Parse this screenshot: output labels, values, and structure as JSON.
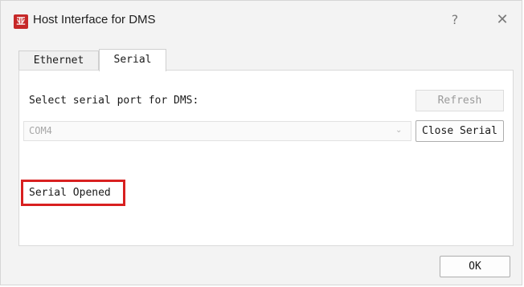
{
  "window": {
    "title": "Host Interface for DMS",
    "app_icon_glyph": "亚",
    "help_glyph": "?",
    "close_glyph": "✕"
  },
  "tabs": [
    {
      "label": "Ethernet",
      "selected": false
    },
    {
      "label": "Serial",
      "selected": true
    }
  ],
  "serial": {
    "select_label": "Select serial port for DMS:",
    "refresh_label": "Refresh",
    "refresh_enabled": false,
    "port_value": "COM4",
    "port_dropdown_icon": "chevron-down-icon",
    "close_serial_label": "Close Serial",
    "status_text": "Serial Opened"
  },
  "footer": {
    "ok_label": "OK"
  },
  "colors": {
    "app_icon_bg": "#c62828",
    "highlight_border": "#d82020"
  }
}
